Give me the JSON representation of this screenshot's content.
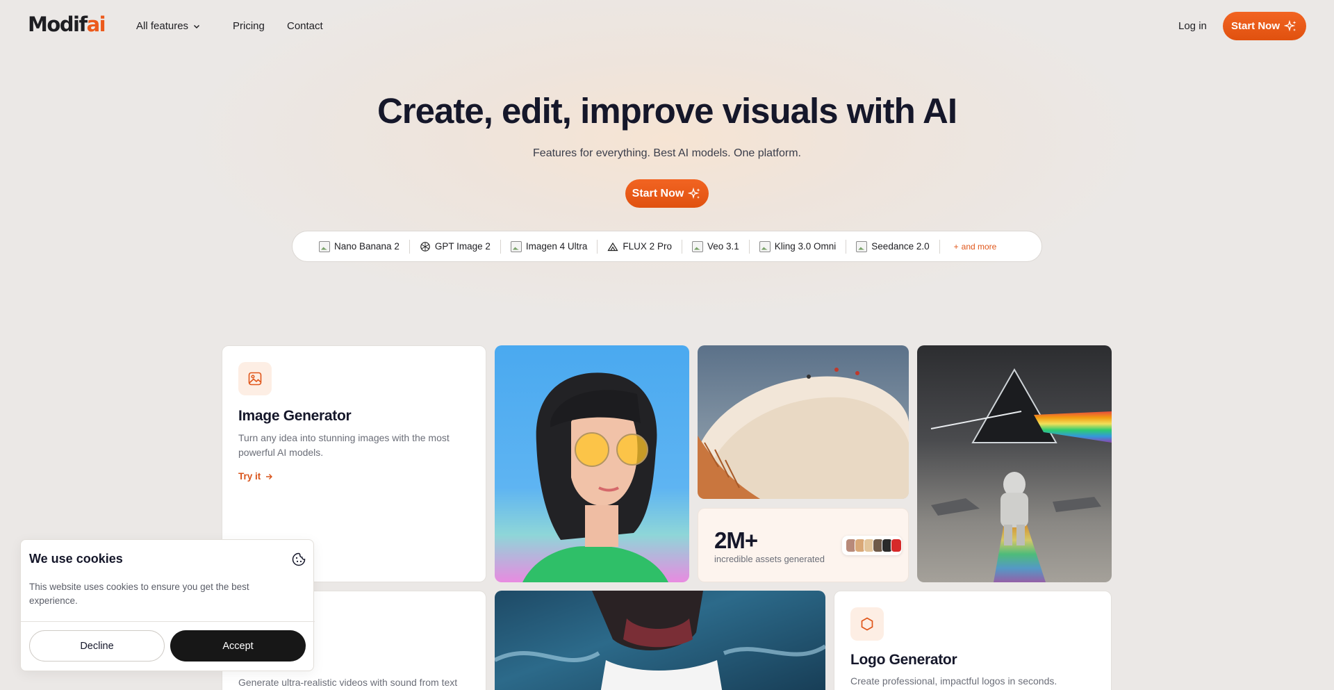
{
  "nav": {
    "logo_text": "Modif",
    "logo_accent": "ai",
    "links": [
      {
        "label": "All features"
      },
      {
        "label": "Pricing"
      },
      {
        "label": "Contact"
      }
    ],
    "login_label": "Log in",
    "start_label": "Start Now"
  },
  "hero": {
    "title": "Create, edit, improve visuals with AI",
    "subtitle": "Features for everything. Best AI models. One platform.",
    "start_label": "Start Now"
  },
  "models": [
    {
      "name": "Nano Banana 2",
      "icon": "image-icon"
    },
    {
      "name": "GPT Image 2",
      "icon": "openai-icon"
    },
    {
      "name": "Imagen 4 Ultra",
      "icon": "image-icon"
    },
    {
      "name": "FLUX 2 Pro",
      "icon": "flux-icon"
    },
    {
      "name": "Veo 3.1",
      "icon": "image-icon"
    },
    {
      "name": "Kling 3.0 Omni",
      "icon": "image-icon"
    },
    {
      "name": "Seedance 2.0",
      "icon": "image-icon"
    }
  ],
  "and_more": "and more",
  "cards": {
    "image_generator": {
      "title": "Image Generator",
      "desc_line1": "Turn any idea into stunning images with the most",
      "desc_line2": "powerful AI models.",
      "cta": "Try it"
    },
    "video_generator": {
      "title": "erator",
      "desc": "Generate ultra-realistic videos with sound from text"
    },
    "logo_generator": {
      "title": "Logo Generator",
      "desc": "Create professional, impactful logos in seconds."
    }
  },
  "stat": {
    "value": "2M+",
    "label": "incredible assets generated"
  },
  "cookie": {
    "title": "We use cookies",
    "text": "This website uses cookies to ensure you get the best experience.",
    "decline": "Decline",
    "accept": "Accept"
  },
  "colors": {
    "accent": "#ec5a1c",
    "background": "#ebe8e6",
    "dark": "#15172a"
  }
}
